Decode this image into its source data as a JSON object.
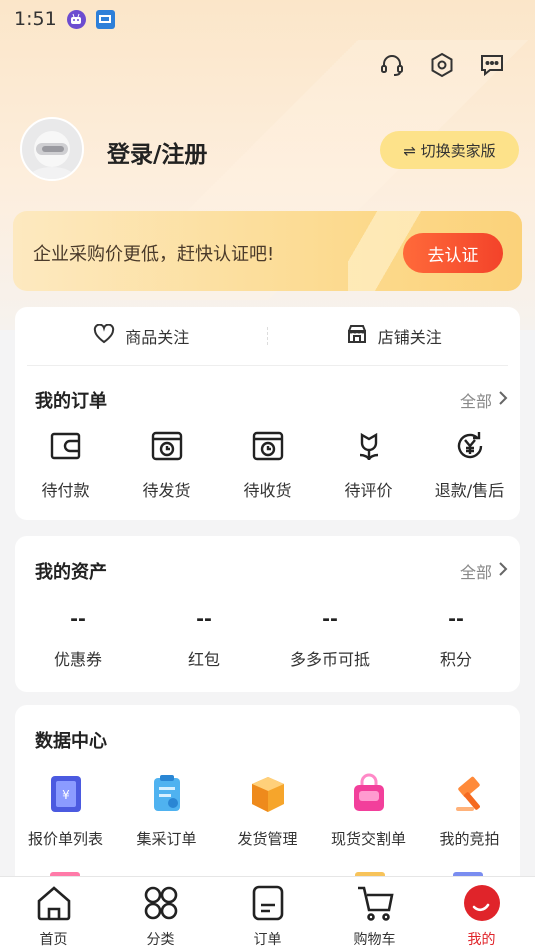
{
  "status_bar": {
    "time": "1:51",
    "icons": [
      "android-robot-icon",
      "app-notification-icon"
    ]
  },
  "header": {
    "icons": [
      "customer-service-icon",
      "settings-icon",
      "message-icon"
    ],
    "login_text": "登录/注册",
    "switch_seller_label": "⇌ 切换卖家版"
  },
  "banner": {
    "text": "企业采购价更低，赶快认证吧!",
    "button_label": "去认证"
  },
  "follow": {
    "product_label": "商品关注",
    "store_label": "店铺关注"
  },
  "orders": {
    "title": "我的订单",
    "all_label": "全部",
    "items": [
      {
        "label": "待付款",
        "icon": "wallet-icon"
      },
      {
        "label": "待发货",
        "icon": "clock-box-icon"
      },
      {
        "label": "待收货",
        "icon": "clock-box-icon"
      },
      {
        "label": "待评价",
        "icon": "flower-icon"
      },
      {
        "label": "退款/售后",
        "icon": "yen-refund-icon"
      }
    ]
  },
  "assets": {
    "title": "我的资产",
    "all_label": "全部",
    "items": [
      {
        "value": "--",
        "label": "优惠券"
      },
      {
        "value": "--",
        "label": "红包"
      },
      {
        "value": "--",
        "label": "多多币可抵"
      },
      {
        "value": "--",
        "label": "积分"
      }
    ]
  },
  "data_center": {
    "title": "数据中心",
    "items": [
      {
        "label": "报价单列表",
        "icon": "quote-list-icon"
      },
      {
        "label": "集采订单",
        "icon": "clipboard-icon"
      },
      {
        "label": "发货管理",
        "icon": "shipping-box-icon"
      },
      {
        "label": "现货交割单",
        "icon": "shopping-bag-icon"
      },
      {
        "label": "我的竞拍",
        "icon": "auction-hammer-icon"
      }
    ]
  },
  "tabbar": {
    "items": [
      {
        "label": "首页",
        "icon": "home-icon"
      },
      {
        "label": "分类",
        "icon": "category-icon"
      },
      {
        "label": "订单",
        "icon": "order-icon"
      },
      {
        "label": "购物车",
        "icon": "cart-icon"
      },
      {
        "label": "我的",
        "icon": "profile-icon"
      }
    ],
    "active": "我的"
  },
  "colors": {
    "accent": "#e0242a",
    "banner_button": "#f3432a",
    "seller_button": "#fde28a"
  }
}
